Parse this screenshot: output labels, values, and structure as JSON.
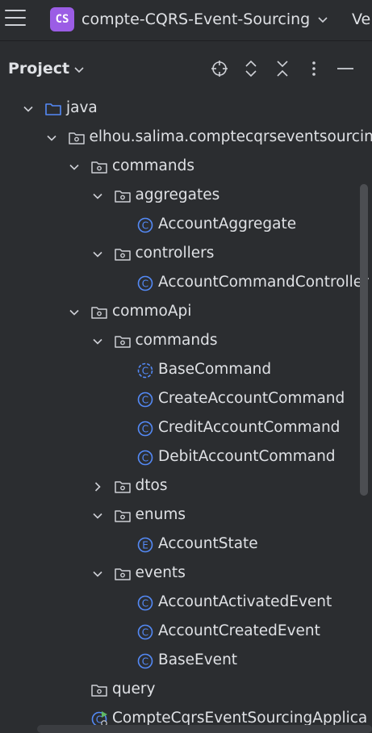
{
  "window": {
    "project_badge": "CS",
    "project_name": "compte-CQRS-Event-Sourcing",
    "vcs_label": "Ve"
  },
  "panel": {
    "title": "Project",
    "toolbar_icons": [
      "locate-icon",
      "expand-all-icon",
      "collapse-all-icon",
      "more-icon",
      "minimize-icon"
    ]
  },
  "tree": [
    {
      "label": "java",
      "indent": 0,
      "arrow": "down",
      "icon": "source-folder"
    },
    {
      "label": "elhou.salima.comptecqrseventsourcin",
      "indent": 1,
      "arrow": "down",
      "icon": "package"
    },
    {
      "label": "commands",
      "indent": 2,
      "arrow": "down",
      "icon": "package"
    },
    {
      "label": "aggregates",
      "indent": 3,
      "arrow": "down",
      "icon": "package"
    },
    {
      "label": "AccountAggregate",
      "indent": 4,
      "arrow": "none",
      "icon": "class"
    },
    {
      "label": "controllers",
      "indent": 3,
      "arrow": "down",
      "icon": "package"
    },
    {
      "label": "AccountCommandController",
      "indent": 4,
      "arrow": "none",
      "icon": "class"
    },
    {
      "label": "commoApi",
      "indent": 2,
      "arrow": "down",
      "icon": "package"
    },
    {
      "label": "commands",
      "indent": 3,
      "arrow": "down",
      "icon": "package"
    },
    {
      "label": "BaseCommand",
      "indent": 4,
      "arrow": "none",
      "icon": "abstract-class"
    },
    {
      "label": "CreateAccountCommand",
      "indent": 4,
      "arrow": "none",
      "icon": "class"
    },
    {
      "label": "CreditAccountCommand",
      "indent": 4,
      "arrow": "none",
      "icon": "class"
    },
    {
      "label": "DebitAccountCommand",
      "indent": 4,
      "arrow": "none",
      "icon": "class"
    },
    {
      "label": "dtos",
      "indent": 3,
      "arrow": "right",
      "icon": "package"
    },
    {
      "label": "enums",
      "indent": 3,
      "arrow": "down",
      "icon": "package"
    },
    {
      "label": "AccountState",
      "indent": 4,
      "arrow": "none",
      "icon": "enum"
    },
    {
      "label": "events",
      "indent": 3,
      "arrow": "down",
      "icon": "package"
    },
    {
      "label": "AccountActivatedEvent",
      "indent": 4,
      "arrow": "none",
      "icon": "class"
    },
    {
      "label": "AccountCreatedEvent",
      "indent": 4,
      "arrow": "none",
      "icon": "class"
    },
    {
      "label": "BaseEvent",
      "indent": 4,
      "arrow": "none",
      "icon": "class"
    },
    {
      "label": "query",
      "indent": 2,
      "arrow": "none",
      "icon": "package"
    },
    {
      "label": "CompteCqrsEventSourcingApplica",
      "indent": 2,
      "arrow": "none",
      "icon": "spring-app"
    }
  ],
  "colors": {
    "background": "#2b2d30",
    "text": "#dfe1e5",
    "class_icon": "#548af7",
    "badge": "#9b5de5"
  }
}
